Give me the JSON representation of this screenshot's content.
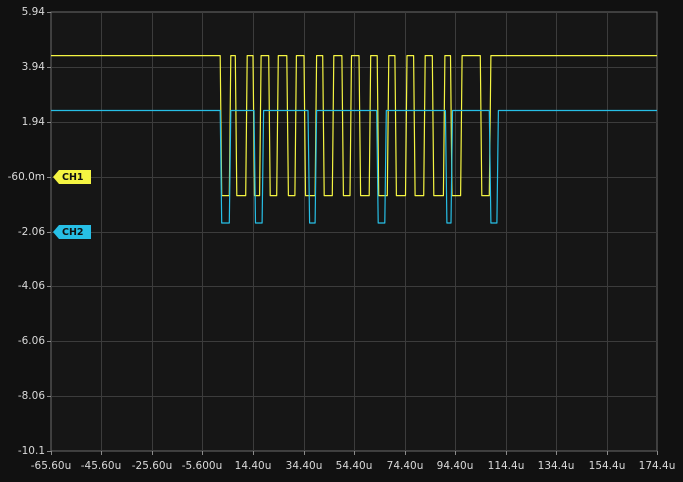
{
  "chart_data": {
    "type": "line",
    "title": "",
    "xlabel": "",
    "ylabel": "",
    "xlim": [
      -65.6,
      174.4
    ],
    "ylim": [
      -10.06,
      5.94
    ],
    "x_unit": "u",
    "grid": true,
    "y_tick_labels": [
      "5.94",
      "3.94",
      "1.94",
      "-60.0m",
      "-2.06",
      "-4.06",
      "-6.06",
      "-8.06",
      "-10.1"
    ],
    "y_tick_values": [
      5.94,
      3.94,
      1.94,
      -0.06,
      -2.06,
      -4.06,
      -6.06,
      -8.06,
      -10.06
    ],
    "x_tick_labels": [
      "-65.60u",
      "-45.60u",
      "-25.60u",
      "-5.600u",
      "14.40u",
      "34.40u",
      "54.40u",
      "74.40u",
      "94.40u",
      "114.4u",
      "134.4u",
      "154.4u",
      "174.4u"
    ],
    "x_tick_values": [
      -65.6,
      -45.6,
      -25.6,
      -5.6,
      14.4,
      34.4,
      54.4,
      74.4,
      94.4,
      114.4,
      134.4,
      154.4,
      174.4
    ],
    "markers": [
      {
        "label": "CH1",
        "level": -0.06,
        "color": "#f5f542"
      },
      {
        "label": "CH2",
        "level": -2.06,
        "color": "#27bfe6"
      }
    ],
    "series": [
      {
        "name": "CH1",
        "color": "#f5f542",
        "high": 4.35,
        "low": -0.75,
        "transitions": [
          1.4,
          5.0,
          7.4,
          11.5,
          14.4,
          17.0,
          20.6,
          23.8,
          27.8,
          31.0,
          34.6,
          39.0,
          42.0,
          45.8,
          49.6,
          52.8,
          56.4,
          60.4,
          63.6,
          67.6,
          70.6,
          74.8,
          78.0,
          82.0,
          85.4,
          89.8,
          92.6,
          96.6,
          104.4,
          108.0
        ],
        "end_x": 174.4
      },
      {
        "name": "CH2",
        "color": "#27bfe6",
        "high": 2.35,
        "low": -1.75,
        "transitions": [
          1.4,
          5.0,
          14.8,
          18.0,
          36.2,
          39.0,
          63.4,
          66.6,
          90.6,
          92.8,
          108.0,
          111.0
        ],
        "end_x": 174.4
      }
    ]
  }
}
